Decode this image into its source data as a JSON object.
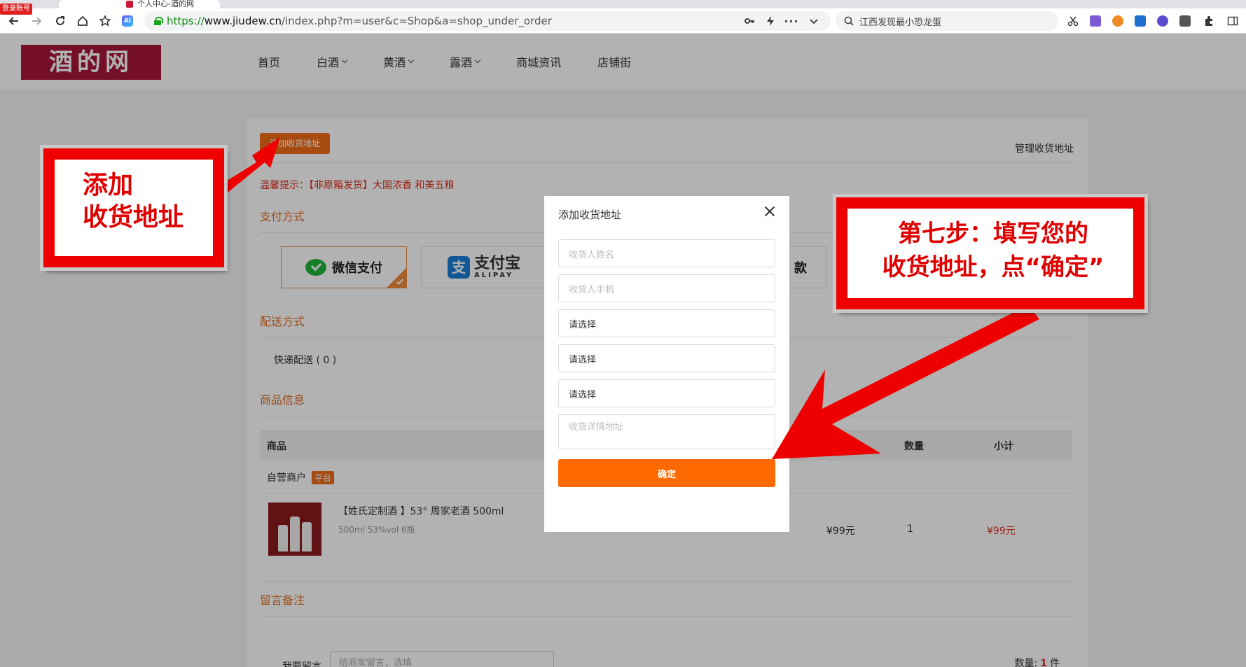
{
  "browser": {
    "tab_title": "个人中心-酒的网",
    "login_badge": "登录账号",
    "url_protocol": "https://",
    "url_host": "www.jiudew.cn",
    "url_path": "/index.php?m=user&c=Shop&a=shop_under_order",
    "search_text": "江西发现最小恐龙蛋"
  },
  "header": {
    "logo": "酒的网",
    "nav": [
      {
        "label": "首页",
        "dropdown": false
      },
      {
        "label": "白酒",
        "dropdown": true
      },
      {
        "label": "黄酒",
        "dropdown": true
      },
      {
        "label": "露酒",
        "dropdown": true
      },
      {
        "label": "商城资讯",
        "dropdown": false
      },
      {
        "label": "店铺街",
        "dropdown": false
      }
    ]
  },
  "order": {
    "add_address_btn": "添加收货地址",
    "manage_address": "管理收货地址",
    "tip": "温馨提示：【非原箱发货】大国浓香 和美五粮",
    "payment_title": "支付方式",
    "pay_wechat": "微信支付",
    "pay_alipay_cn": "支付宝",
    "pay_alipay_en": "ALIPAY",
    "pay_other_partial": "款",
    "delivery_title": "配送方式",
    "express": "快递配送 ( 0 )",
    "goods_title": "商品信息",
    "table_headers": {
      "goods": "商品",
      "qty": "数量",
      "subtotal": "小计"
    },
    "shop_name": "自营商户",
    "shop_badge": "平台",
    "product": {
      "name": "【姓氏定制酒 】53° 周家老酒 500ml",
      "spec": "500ml  53%vol  6瓶",
      "price": "¥99元",
      "qty": "1",
      "subtotal": "¥99元"
    },
    "remark_title": "留言备注",
    "remark_label": "我要留言",
    "remark_placeholder": "给商家留言，选填",
    "qty_label": "数量:",
    "qty_value": "1",
    "qty_unit": "件"
  },
  "modal": {
    "title": "添加收货地址",
    "name_placeholder": "收货人姓名",
    "phone_placeholder": "收货人手机",
    "select1": "请选择",
    "select2": "请选择",
    "select3": "请选择",
    "detail_placeholder": "收货详情地址",
    "confirm": "确定"
  },
  "annotations": {
    "left_line1": "添加",
    "left_line2": "收货地址",
    "right_line1": "第七步：填写您的",
    "right_line2": "收货地址，点“确定”"
  },
  "colors": {
    "brand": "#a8163a",
    "accent_orange": "#ff6a00",
    "annotation_red": "#ee0000",
    "price_red": "#d92c1c"
  }
}
